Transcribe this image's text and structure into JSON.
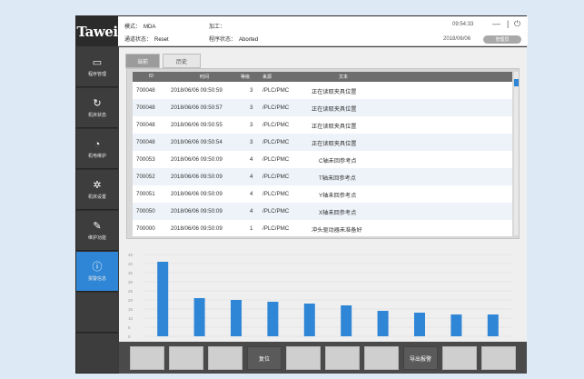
{
  "brand": {
    "logo_text": "Tawei"
  },
  "status": {
    "mode_label": "模式：",
    "mode_value": "MDA",
    "process_label": "加工：",
    "process_value": "",
    "channel_label": "通道状态：",
    "channel_value": "Reset",
    "program_label": "程序状态：",
    "program_value": "Aborted",
    "time": "09:54:33",
    "date": "2018/06/06",
    "user": "管理员"
  },
  "window": {
    "minimize": "—",
    "divider": "|",
    "power": "⏻"
  },
  "sidebar": {
    "items": [
      {
        "label": "程序管理",
        "icon": "folder-icon",
        "glyph": "▭"
      },
      {
        "label": "机床状态",
        "icon": "refresh-icon",
        "glyph": "↻"
      },
      {
        "label": "机电维护",
        "icon": "gauge-icon",
        "glyph": "◔"
      },
      {
        "label": "机床设置",
        "icon": "gear-icon",
        "glyph": "✲"
      },
      {
        "label": "维护功能",
        "icon": "wrench-icon",
        "glyph": "✎"
      },
      {
        "label": "报警信息",
        "icon": "info-icon",
        "glyph": "ⓘ",
        "active": true
      }
    ]
  },
  "tabs": {
    "current": "当前",
    "history": "历史"
  },
  "table": {
    "headers": [
      "ID",
      "时间",
      "等级",
      "来源",
      "文本"
    ],
    "rows": [
      {
        "id": "700048",
        "time": "2018/06/06 09:50:59",
        "level": "3",
        "source": "/PLC/PMC",
        "text": "正在读取夹具位置"
      },
      {
        "id": "700048",
        "time": "2018/06/06 09:50:57",
        "level": "3",
        "source": "/PLC/PMC",
        "text": "正在读取夹具位置"
      },
      {
        "id": "700048",
        "time": "2018/06/06 09:50:55",
        "level": "3",
        "source": "/PLC/PMC",
        "text": "正在读取夹具位置"
      },
      {
        "id": "700048",
        "time": "2018/06/06 09:50:54",
        "level": "3",
        "source": "/PLC/PMC",
        "text": "正在读取夹具位置"
      },
      {
        "id": "700053",
        "time": "2018/06/06 09:50:09",
        "level": "4",
        "source": "/PLC/PMC",
        "text": "C轴未回参考点"
      },
      {
        "id": "700052",
        "time": "2018/06/06 09:50:09",
        "level": "4",
        "source": "/PLC/PMC",
        "text": "T轴未回参考点"
      },
      {
        "id": "700051",
        "time": "2018/06/06 09:50:09",
        "level": "4",
        "source": "/PLC/PMC",
        "text": "Y轴未回参考点"
      },
      {
        "id": "700050",
        "time": "2018/06/06 09:50:09",
        "level": "4",
        "source": "/PLC/PMC",
        "text": "X轴未回参考点"
      },
      {
        "id": "700000",
        "time": "2018/06/06 09:50:09",
        "level": "1",
        "source": "/PLC/PMC",
        "text": "冲头驱动器未准备好"
      }
    ]
  },
  "chart_data": {
    "type": "bar",
    "title": "",
    "ylim": [
      0,
      45
    ],
    "yticks": [
      "45",
      "40",
      "35",
      "30",
      "25",
      "20",
      "15",
      "10",
      "5",
      "0"
    ],
    "values": [
      41,
      21,
      20,
      19,
      18,
      17,
      14,
      13,
      12,
      12
    ],
    "color": "#2f86d6"
  },
  "softkeys": [
    "",
    "",
    "",
    "复位",
    "",
    "",
    "",
    "导出报警",
    "",
    ""
  ]
}
